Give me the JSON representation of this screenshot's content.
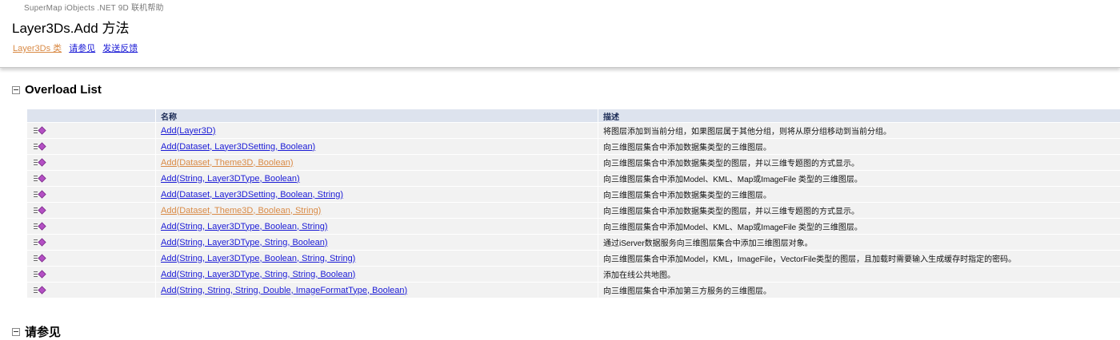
{
  "header": {
    "product": "SuperMap iObjects .NET 9D 联机帮助",
    "title": "Layer3Ds.Add 方法",
    "links": [
      {
        "label": "Layer3Ds 类",
        "visited": true
      },
      {
        "label": "请参见",
        "visited": false
      },
      {
        "label": "发送反馈",
        "visited": false
      }
    ]
  },
  "overload": {
    "heading": "Overload List",
    "col_name": "名称",
    "col_desc": "描述",
    "rows": [
      {
        "name": "Add(Layer3D)",
        "desc": "将图层添加到当前分组，如果图层属于其他分组，则将从原分组移动到当前分组。",
        "visited": false
      },
      {
        "name": "Add(Dataset, Layer3DSetting, Boolean)",
        "desc": "向三维图层集合中添加数据集类型的三维图层。",
        "visited": false
      },
      {
        "name": "Add(Dataset, Theme3D, Boolean)",
        "desc": "向三维图层集合中添加数据集类型的图层，并以三维专题图的方式显示。",
        "visited": true
      },
      {
        "name": "Add(String, Layer3DType, Boolean)",
        "desc": "向三维图层集合中添加Model、KML、Map或ImageFile 类型的三维图层。",
        "visited": false
      },
      {
        "name": "Add(Dataset, Layer3DSetting, Boolean, String)",
        "desc": "向三维图层集合中添加数据集类型的三维图层。",
        "visited": false
      },
      {
        "name": "Add(Dataset, Theme3D, Boolean, String)",
        "desc": "向三维图层集合中添加数据集类型的图层，并以三维专题图的方式显示。",
        "visited": true
      },
      {
        "name": "Add(String, Layer3DType, Boolean, String)",
        "desc": "向三维图层集合中添加Model、KML、Map或ImageFile 类型的三维图层。",
        "visited": false
      },
      {
        "name": "Add(String, Layer3DType, String, Boolean)",
        "desc": "通过iServer数据服务向三维图层集合中添加三维图层对象。",
        "visited": false
      },
      {
        "name": "Add(String, Layer3DType, Boolean, String, String)",
        "desc": "向三维图层集合中添加Model，KML，ImageFile，VectorFile类型的图层，且加载时需要输入生成缓存时指定的密码。",
        "visited": false
      },
      {
        "name": "Add(String, Layer3DType, String, String, Boolean)",
        "desc": "添加在线公共地图。",
        "visited": false
      },
      {
        "name": "Add(String, String, String, Double, ImageFormatType, Boolean)",
        "desc": "向三维图层集合中添加第三方服务的三维图层。",
        "visited": false
      }
    ]
  },
  "see_also": {
    "heading": "请参见"
  },
  "icons": {
    "row_icon": "public-method-icon",
    "section_toggle": "collapse-icon"
  },
  "colors": {
    "link": "#1a1ad6",
    "visited_link": "#d98a45",
    "table_header": "#dde3ee",
    "row_bg": "#f2f2f2"
  }
}
